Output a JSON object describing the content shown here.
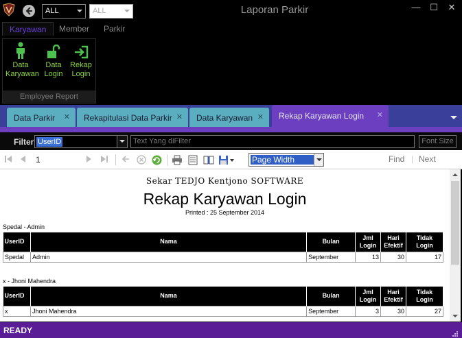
{
  "window": {
    "title": "Laporan Parkir",
    "combo1_value": "ALL",
    "combo2_value": "ALL",
    "minimize": "—",
    "maximize": "☐",
    "close": "✕"
  },
  "ribbon": {
    "tabs": [
      "Karyawan",
      "Member",
      "Parkir"
    ],
    "active_tab": "Karyawan",
    "buttons": [
      {
        "label_line1": "Data",
        "label_line2": "Karyawan",
        "icon": "person-icon"
      },
      {
        "label_line1": "Data",
        "label_line2": "Login",
        "icon": "unlock-icon"
      },
      {
        "label_line1": "Rekap",
        "label_line2": "Login",
        "icon": "login-arrow-icon"
      }
    ],
    "group_label": "Employee Report"
  },
  "doc_tabs": [
    {
      "label": "Data Parkir",
      "close": "✕"
    },
    {
      "label": "Rekapitulasi Data Parkir",
      "close": "✕"
    },
    {
      "label": "Data Karyawan",
      "close": "✕"
    },
    {
      "label": "Rekap Karyawan Login",
      "close": "✕"
    }
  ],
  "filter": {
    "label": "Filter",
    "field_value": "UserID",
    "placeholder": "Text Yang diFilter",
    "font_size_label": "Font Size"
  },
  "toolbar": {
    "page_number": "1",
    "zoom": "Page Width",
    "find_label": "Find",
    "divider": "|",
    "next_label": "Next"
  },
  "report": {
    "company": "Sekar TEDJO Kentjono SOFTWARE",
    "title": "Rekap Karyawan Login",
    "printed": "Printed : 25 September 2014",
    "columns": {
      "userid": "UserID",
      "nama": "Nama",
      "bulan": "Bulan",
      "jml_login": "Jml Login",
      "hari_efektif": "Hari Efektif",
      "tidak_login": "Tidak Login"
    },
    "groups": [
      {
        "label": "Spedal - Admin",
        "row": {
          "userid": "Spedal",
          "nama": "Admin",
          "bulan": "September",
          "jml_login": "13",
          "hari_efektif": "30",
          "tidak_login": "17"
        }
      },
      {
        "label": "x - Jhoni Mahendra",
        "row": {
          "userid": "x",
          "nama": "Jhoni Mahendra",
          "bulan": "September",
          "jml_login": "3",
          "hari_efektif": "30",
          "tidak_login": "27"
        }
      }
    ]
  },
  "status": {
    "text": "READY"
  },
  "colors": {
    "accent_purple": "#6c3fc0",
    "status_purple": "#5b1d96",
    "tab_teal": "#5aaec0",
    "ribbon_green": "#8dd63a"
  }
}
